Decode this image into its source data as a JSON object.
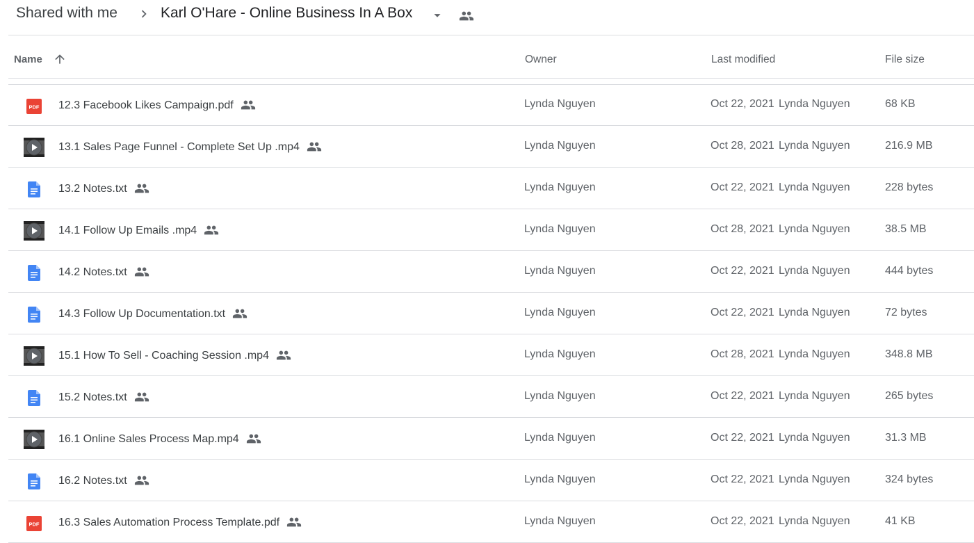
{
  "breadcrumb": {
    "root": "Shared with me",
    "current": "Karl O'Hare - Online Business In A Box"
  },
  "columns": {
    "name": "Name",
    "owner": "Owner",
    "modified": "Last modified",
    "size": "File size"
  },
  "colors": {
    "pdf_red": "#ea4335",
    "doc_blue": "#4285f4",
    "icon_gray": "#5f6368",
    "divider": "#dadce0"
  },
  "files": [
    {
      "name": "12.3 Facebook Likes Campaign.pdf",
      "type": "pdf",
      "icon": "pdf-icon",
      "owner": "Lynda Nguyen",
      "modified": "Oct 22, 2021",
      "modified_by": "Lynda Nguyen",
      "size": "68 KB"
    },
    {
      "name": "13.1 Sales Page Funnel - Complete Set Up .mp4",
      "type": "video",
      "icon": "video-icon",
      "owner": "Lynda Nguyen",
      "modified": "Oct 28, 2021",
      "modified_by": "Lynda Nguyen",
      "size": "216.9 MB"
    },
    {
      "name": "13.2 Notes.txt",
      "type": "doc",
      "icon": "document-icon",
      "owner": "Lynda Nguyen",
      "modified": "Oct 22, 2021",
      "modified_by": "Lynda Nguyen",
      "size": "228 bytes"
    },
    {
      "name": "14.1  Follow Up Emails .mp4",
      "type": "video",
      "icon": "video-icon",
      "owner": "Lynda Nguyen",
      "modified": "Oct 28, 2021",
      "modified_by": "Lynda Nguyen",
      "size": "38.5 MB"
    },
    {
      "name": "14.2 Notes.txt",
      "type": "doc",
      "icon": "document-icon",
      "owner": "Lynda Nguyen",
      "modified": "Oct 22, 2021",
      "modified_by": "Lynda Nguyen",
      "size": "444 bytes"
    },
    {
      "name": "14.3 Follow Up Documentation.txt",
      "type": "doc",
      "icon": "document-icon",
      "owner": "Lynda Nguyen",
      "modified": "Oct 22, 2021",
      "modified_by": "Lynda Nguyen",
      "size": "72 bytes"
    },
    {
      "name": "15.1  How To Sell - Coaching Session .mp4",
      "type": "video",
      "icon": "video-icon",
      "owner": "Lynda Nguyen",
      "modified": "Oct 28, 2021",
      "modified_by": "Lynda Nguyen",
      "size": "348.8 MB"
    },
    {
      "name": "15.2 Notes.txt",
      "type": "doc",
      "icon": "document-icon",
      "owner": "Lynda Nguyen",
      "modified": "Oct 22, 2021",
      "modified_by": "Lynda Nguyen",
      "size": "265 bytes"
    },
    {
      "name": "16.1  Online Sales Process Map.mp4",
      "type": "video",
      "icon": "video-icon",
      "owner": "Lynda Nguyen",
      "modified": "Oct 22, 2021",
      "modified_by": "Lynda Nguyen",
      "size": "31.3 MB"
    },
    {
      "name": "16.2 Notes.txt",
      "type": "doc",
      "icon": "document-icon",
      "owner": "Lynda Nguyen",
      "modified": "Oct 22, 2021",
      "modified_by": "Lynda Nguyen",
      "size": "324 bytes"
    },
    {
      "name": "16.3 Sales Automation Process Template.pdf",
      "type": "pdf",
      "icon": "pdf-icon",
      "owner": "Lynda Nguyen",
      "modified": "Oct 22, 2021",
      "modified_by": "Lynda Nguyen",
      "size": "41 KB"
    }
  ]
}
